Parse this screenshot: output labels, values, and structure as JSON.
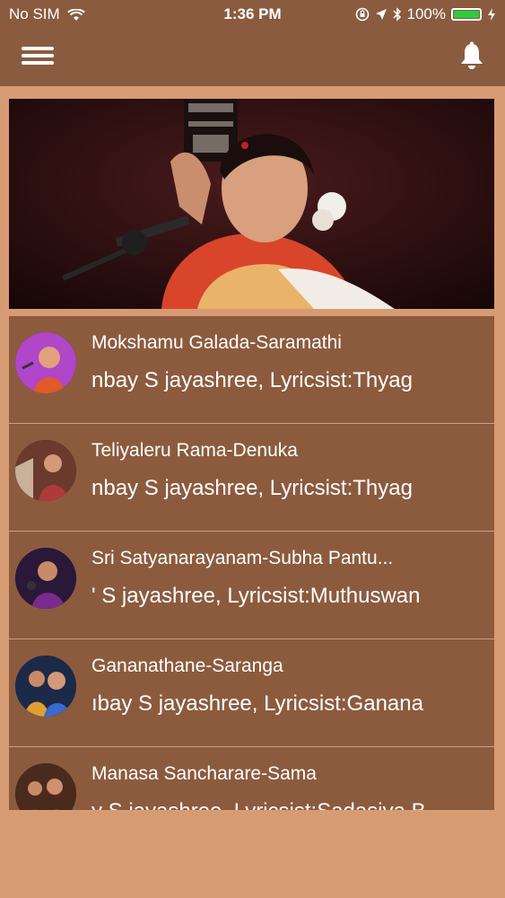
{
  "status_bar": {
    "carrier": "No SIM",
    "time": "1:36 PM",
    "battery": "100%",
    "battery_color": "#2ecc40"
  },
  "nav": {
    "background": "#8a5b3f",
    "menu_icon": "hamburger-icon",
    "bell_icon": "bell-icon"
  },
  "songs": [
    {
      "title": "Mokshamu Galada-Saramathi",
      "subtitle": "nbay S jayashree, Lyricsist:Thyag"
    },
    {
      "title": "Teliyaleru Rama-Denuka",
      "subtitle": "nbay S jayashree, Lyricsist:Thyag"
    },
    {
      "title": "Sri Satyanarayanam-Subha Pantu...",
      "subtitle": "' S jayashree, Lyricsist:Muthuswan"
    },
    {
      "title": "Gananathane-Saranga",
      "subtitle": "ıbay S jayashree, Lyricsist:Ganana"
    },
    {
      "title": "Manasa Sancharare-Sama",
      "subtitle": "y S jayashree, Lyricsist:Sadasiva B"
    }
  ]
}
